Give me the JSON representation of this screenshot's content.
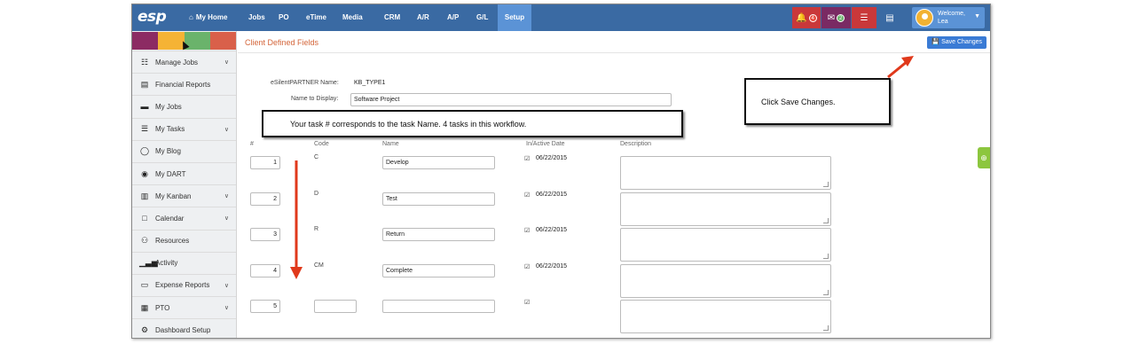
{
  "nav": {
    "logo": "esp",
    "home_label": "My Home",
    "items": [
      "Jobs",
      "PO",
      "eTime",
      "Media",
      "CRM",
      "A/R",
      "A/P",
      "G/L",
      "Setup"
    ],
    "active_item": "Setup",
    "alerts_count": "4",
    "messages_count": "2",
    "welcome_line1": "Welcome,",
    "welcome_line2": "Lea"
  },
  "sidebar": {
    "swatch_colors": [
      "#8c2b63",
      "#f5b335",
      "#6ab36b",
      "#d9604a"
    ],
    "items": [
      {
        "label": "Manage Jobs",
        "icon": "sitemap-icon",
        "caret": true
      },
      {
        "label": "Financial Reports",
        "icon": "report-icon",
        "caret": false
      },
      {
        "label": "My Jobs",
        "icon": "folder-icon",
        "caret": false
      },
      {
        "label": "My Tasks",
        "icon": "tasks-icon",
        "caret": true
      },
      {
        "label": "My Blog",
        "icon": "comments-icon",
        "caret": false
      },
      {
        "label": "My DART",
        "icon": "dart-icon",
        "caret": false
      },
      {
        "label": "My Kanban",
        "icon": "map-icon",
        "caret": true
      },
      {
        "label": "Calendar",
        "icon": "calendar-icon",
        "caret": true
      },
      {
        "label": "Resources",
        "icon": "users-icon",
        "caret": false
      },
      {
        "label": "Activity",
        "icon": "bars-icon",
        "caret": false
      },
      {
        "label": "Expense Reports",
        "icon": "money-icon",
        "caret": true
      },
      {
        "label": "PTO",
        "icon": "calendar-grid-icon",
        "caret": true
      },
      {
        "label": "Dashboard Setup",
        "icon": "cogs-icon",
        "caret": false
      }
    ]
  },
  "main": {
    "title": "Client Defined Fields",
    "save_label": "Save Changes",
    "partner_label": "eSilentPARTNER Name:",
    "partner_value": "KB_TYPE1",
    "display_label": "Name to Display:",
    "display_value": "Software Project",
    "headers": {
      "num": "#",
      "code": "Code",
      "name": "Name",
      "date": "In/Active Date",
      "description": "Description"
    },
    "rows": [
      {
        "num": "1",
        "code": "C",
        "name": "Develop",
        "checked": true,
        "date": "06/22/2015"
      },
      {
        "num": "2",
        "code": "D",
        "name": "Test",
        "checked": true,
        "date": "06/22/2015"
      },
      {
        "num": "3",
        "code": "R",
        "name": "Return",
        "checked": true,
        "date": "06/22/2015"
      },
      {
        "num": "4",
        "code": "CM",
        "name": "Complete",
        "checked": true,
        "date": "06/22/2015"
      },
      {
        "num": "5",
        "code": "",
        "name": "",
        "checked": true,
        "date": ""
      }
    ]
  },
  "callouts": {
    "task_note": "Your task # corresponds to the task Name. 4 tasks in this workflow.",
    "save_note": "Click Save Changes."
  },
  "colors": {
    "nav_bg": "#3a6aa3",
    "accent_title": "#d4653a",
    "arrow": "#e0391b",
    "bell_btn": "#c9383a",
    "mail_btn": "#7a2a63",
    "db_btn": "#c9383a"
  }
}
